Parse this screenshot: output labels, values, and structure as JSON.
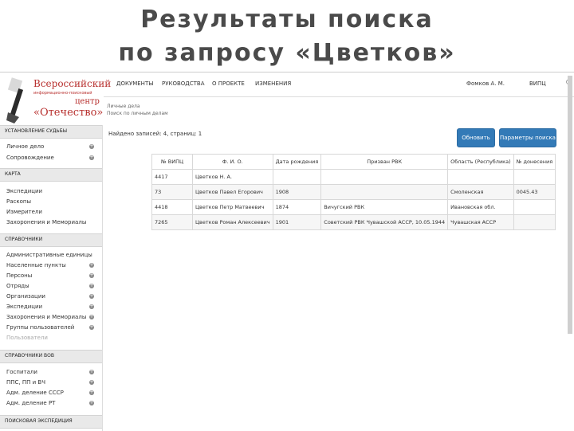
{
  "slide": {
    "title_line1": "Результаты поиска",
    "title_line2": "по запросу «Цветков»"
  },
  "logo": {
    "line1": "Всероссийский",
    "line2": "информационно-поисковый",
    "line3": "центр",
    "line4": "«Отечество»"
  },
  "topnav": {
    "items": [
      "ДОКУМЕНТЫ",
      "РУКОВОДСТВА",
      "О ПРОЕКТЕ",
      "ИЗМЕНЕНИЯ"
    ],
    "user": "Фомков А. М.",
    "org": "ВИПЦ"
  },
  "sidebar": {
    "sections": [
      {
        "title": "УСТАНОВЛЕНИЕ СУДЬБЫ",
        "items": [
          {
            "label": "Личное дело",
            "plus": true
          },
          {
            "label": "Сопровождение",
            "plus": true
          }
        ]
      },
      {
        "title": "КАРТА",
        "items": [
          {
            "label": "Экспедиции",
            "plus": false
          },
          {
            "label": "Раскопы",
            "plus": false
          },
          {
            "label": "Измерители",
            "plus": false
          },
          {
            "label": "Захоронения и Мемориалы",
            "plus": false
          }
        ]
      },
      {
        "title": "СПРАВОЧНИКИ",
        "items": [
          {
            "label": "Административные единицы",
            "plus": false
          },
          {
            "label": "Населенные пункты",
            "plus": true
          },
          {
            "label": "Персоны",
            "plus": true
          },
          {
            "label": "Отряды",
            "plus": true
          },
          {
            "label": "Организации",
            "plus": true
          },
          {
            "label": "Экспедиции",
            "plus": true
          },
          {
            "label": "Захоронения и Мемориалы",
            "plus": true
          },
          {
            "label": "Группы пользователей",
            "plus": true
          },
          {
            "label": "Пользователи",
            "plus": false
          }
        ]
      },
      {
        "title": "СПРАВОЧНИКИ ВОВ",
        "items": [
          {
            "label": "Госпитали",
            "plus": true
          },
          {
            "label": "ППС, ПП и ВЧ",
            "plus": true
          },
          {
            "label": "Адм. деление СССР",
            "plus": true
          },
          {
            "label": "Адм. деление РТ",
            "plus": true
          }
        ]
      },
      {
        "title": "ПОИСКОВАЯ ЭКСПЕДИЦИЯ",
        "items": []
      }
    ]
  },
  "content": {
    "breadcrumb1": "Личные дела",
    "breadcrumb2": "Поиск по личным делам",
    "found_text": "Найдено записей: 4, страниц: 1",
    "btn_refresh": "Обновить",
    "btn_params": "Параметры поиска"
  },
  "table": {
    "headers": [
      "№ ВИПЦ",
      "Ф. И. О.",
      "Дата рождения",
      "Призван РВК",
      "Область (Республика)",
      "№ донесения"
    ],
    "rows": [
      [
        "4417",
        "Цветков Н. А.",
        "",
        "",
        "",
        ""
      ],
      [
        "73",
        "Цветков Павел Егорович",
        "1908",
        "",
        "Смоленская",
        "0045.43"
      ],
      [
        "4418",
        "Цветков Петр Матвеевич",
        "1874",
        "Вичугский РВК",
        "Ивановская обл.",
        ""
      ],
      [
        "7265",
        "Цветков Роман Алексеевич",
        "1901",
        "Советский РВК Чувашской АССР, 10.05.1944",
        "Чувашская АССР",
        ""
      ]
    ]
  },
  "colors": {
    "title": "#4a4a4a",
    "logo_red": "#b8312f",
    "button_blue": "#337ab7"
  }
}
